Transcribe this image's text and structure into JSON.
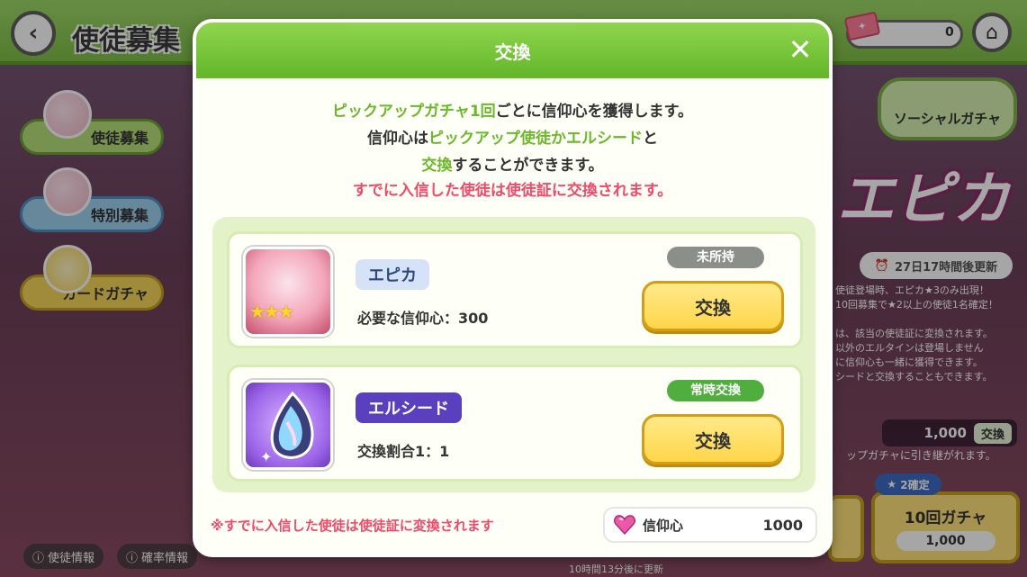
{
  "screen": {
    "title": "使徒募集",
    "ticket_count": "0"
  },
  "sidebar": {
    "items": [
      {
        "label": "使徒募集"
      },
      {
        "label": "特別募集"
      },
      {
        "label": "カードガチャ"
      }
    ]
  },
  "background": {
    "social_gacha": "ソーシャルガチャ",
    "banner_logo": "エピカ",
    "timer": "27日17時間後更新",
    "notes": [
      "使徒登場時、エピカ★3のみ出現！",
      "10回募集で★2以上の使徒1名確定！",
      "は、該当の使徒証に変換されます。",
      "以外のエルタインは登場しません",
      "に信仰心も一緒に獲得できます。",
      "シードと交換することもできます。"
    ],
    "cost_value": "1,000",
    "cost_button": "交換",
    "carry_note": "ップガチャに引き継がれます。",
    "gacha10_badge": "2確定",
    "gacha10_label": "10回ガチャ",
    "gacha10_cost": "1,000",
    "bottom_buttons": [
      "使徒情報",
      "確率情報"
    ],
    "bottom_update": "10時間13分後に更新"
  },
  "modal": {
    "title": "交換",
    "desc": {
      "line1_green": "ピックアップガチャ1回",
      "line1_rest": "ごとに信仰心を獲得します。",
      "line2_a": "信仰心は",
      "line2_green": "ピックアップ使徒かエルシード",
      "line2_b": "と",
      "line3_green": "交換",
      "line3_rest": "することができます。",
      "line4_red": "すでに入信した使徒は使徒証に交換されます。"
    },
    "items": [
      {
        "name": "エピカ",
        "requirement": "必要な信仰心：300",
        "status": "未所持",
        "button": "交換",
        "stars": "★★★",
        "status_color": "#8a8f8a"
      },
      {
        "name": "エルシード",
        "requirement": "交換割合1：1",
        "status": "常時交換",
        "button": "交換",
        "status_color": "#4fae3e"
      }
    ],
    "footer_note": "※すでに入信した使徒は使徒証に変換されます",
    "currency": {
      "label": "信仰心",
      "value": "1000",
      "icon": "heart-gem-icon"
    }
  }
}
